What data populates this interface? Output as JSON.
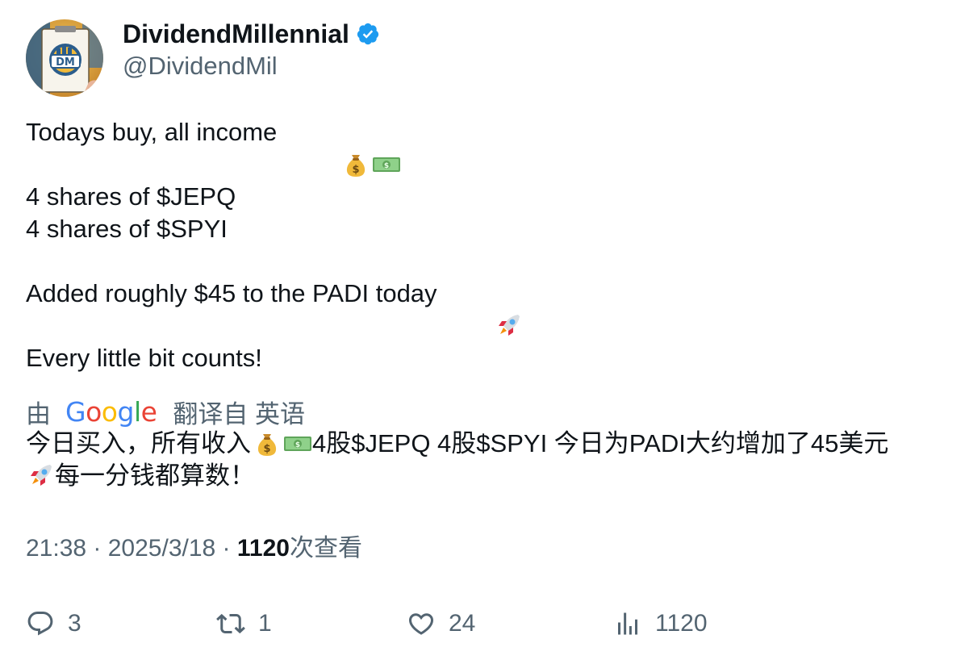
{
  "author": {
    "display_name": "DividendMillennial",
    "handle": "@DividendMil",
    "verified": true,
    "avatar_initials": "DM"
  },
  "tweet": {
    "lines": [
      "Todays buy, all income ",
      "4 shares of $JEPQ",
      "4 shares of $SPYI",
      "Added roughly $45 to the PADI today",
      "Every little bit counts!"
    ]
  },
  "translation": {
    "by_label": "由",
    "provider": "Google",
    "link_text": "翻译自 英语",
    "text_part1": "今日买入，所有收入 ",
    "text_part2": " 4股$JEPQ 4股$SPYI 今日为PADI大约增加了45美元",
    "text_part3": " 每一分钱都算数！"
  },
  "meta": {
    "time": "21:38",
    "sep1": " · ",
    "date": "2025/3/18",
    "sep2": " · ",
    "views_count": "1120",
    "views_label": "次查看"
  },
  "actions": {
    "replies": "3",
    "retweets": "1",
    "likes": "24",
    "views": "1120"
  },
  "colors": {
    "text_primary": "#0f1419",
    "text_secondary": "#536471",
    "verified_blue": "#1d9bf0"
  },
  "icons": {
    "verified": "verified-badge-icon",
    "money_bag": "money-bag-emoji",
    "dollar_bill": "dollar-banknote-emoji",
    "rocket": "rocket-emoji",
    "reply": "reply-icon",
    "retweet": "retweet-icon",
    "like": "heart-icon",
    "views": "analytics-icon"
  }
}
